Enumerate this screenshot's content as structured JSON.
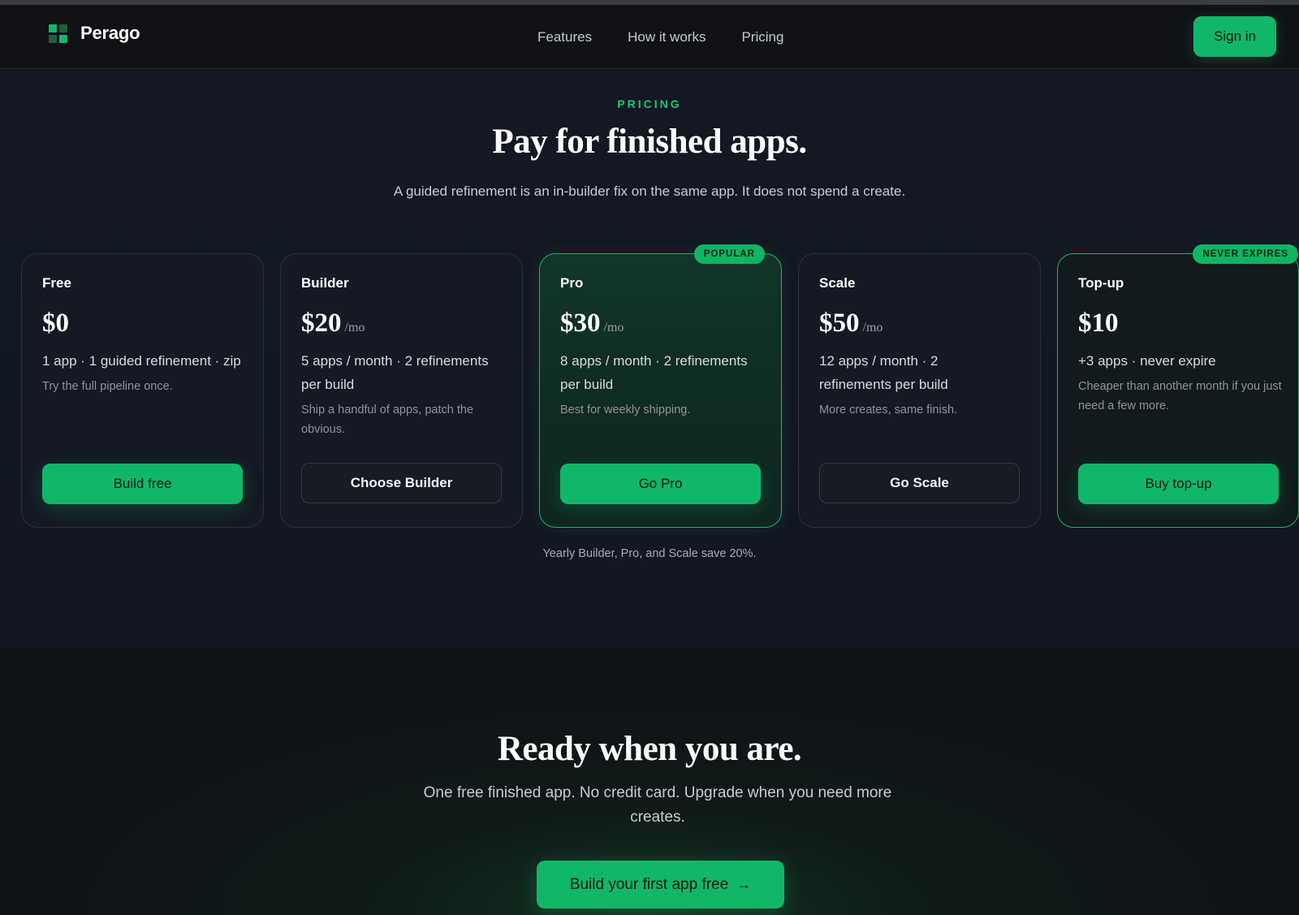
{
  "header": {
    "brand": "Perago",
    "nav": [
      "Features",
      "How it works",
      "Pricing"
    ],
    "signin": "Sign in"
  },
  "pricing": {
    "eyebrow": "PRICING",
    "title": "Pay for finished apps.",
    "subtitle": "A guided refinement is an in-builder fix on the same app. It does not spend a create.",
    "plans": [
      {
        "name": "Free",
        "price": "$0",
        "per": "",
        "features": "1 app · 1 guided refinement · zip",
        "note": "Try the full pipeline once.",
        "cta": "Build free",
        "badge": ""
      },
      {
        "name": "Builder",
        "price": "$20",
        "per": "/mo",
        "features": "5 apps / month · 2 refinements per build",
        "note": "Ship a handful of apps, patch the obvious.",
        "cta": "Choose Builder",
        "badge": ""
      },
      {
        "name": "Pro",
        "price": "$30",
        "per": "/mo",
        "features": "8 apps / month · 2 refinements per build",
        "note": "Best for weekly shipping.",
        "cta": "Go Pro",
        "badge": "POPULAR"
      },
      {
        "name": "Scale",
        "price": "$50",
        "per": "/mo",
        "features": "12 apps / month · 2 refinements per build",
        "note": "More creates, same finish.",
        "cta": "Go Scale",
        "badge": ""
      },
      {
        "name": "Top-up",
        "price": "$10",
        "per": "",
        "features": "+3 apps · never expire",
        "note": "Cheaper than another month if you just need a few more.",
        "cta": "Buy top-up",
        "badge": "NEVER EXPIRES"
      }
    ],
    "save_note": "Yearly Builder, Pro, and Scale save 20%."
  },
  "cta_section": {
    "title": "Ready when you are.",
    "subtitle": "One free finished app. No credit card. Upgrade when you need more creates.",
    "button": "Build your first app free",
    "button_icon": "arrow-right-icon"
  },
  "colors": {
    "accent": "#11b768",
    "background": "#131823",
    "header": "#101216"
  }
}
